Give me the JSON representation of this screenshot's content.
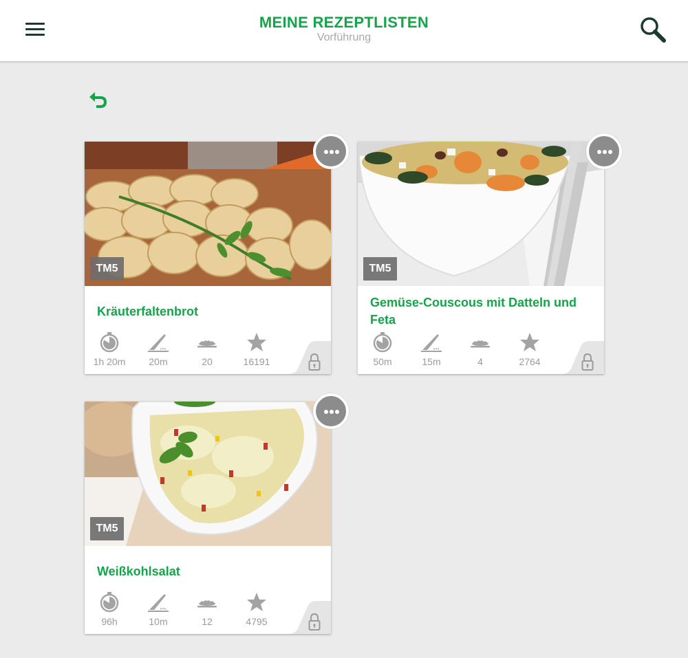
{
  "header": {
    "title": "MEINE REZEPTLISTEN",
    "subtitle": "Vorführung"
  },
  "icons": {
    "menu": "hamburger-menu-icon",
    "search": "search-icon",
    "back": "back-arrow-icon",
    "more": "more-dots-icon",
    "time": "stopwatch-icon",
    "prep": "knife-icon",
    "portions": "dish-icon",
    "rating": "star-icon",
    "lock": "lock-icon"
  },
  "colors": {
    "accent": "#16a34a",
    "header_bg": "#ffffff",
    "page_bg": "#ebebeb",
    "icon_grey": "#a3a3a3",
    "badge_bg": "#6e6e6e"
  },
  "recipes": [
    {
      "title": "Kräuterfaltenbrot",
      "badge": "TM5",
      "total_time": "1h 20m",
      "prep_time": "20m",
      "portions": "20",
      "rating_count": "16191"
    },
    {
      "title": "Gemüse-Couscous mit Datteln und Feta",
      "badge": "TM5",
      "total_time": "50m",
      "prep_time": "15m",
      "portions": "4",
      "rating_count": "2764"
    },
    {
      "title": "Weißkohlsalat",
      "badge": "TM5",
      "total_time": "96h",
      "prep_time": "10m",
      "portions": "12",
      "rating_count": "4795"
    }
  ]
}
